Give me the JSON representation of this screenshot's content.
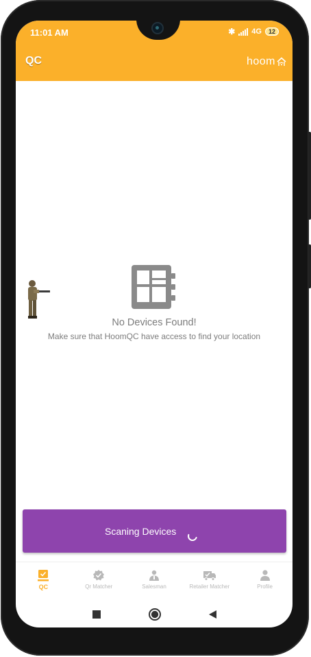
{
  "status_bar": {
    "time": "11:01 AM",
    "network": "4G",
    "battery": "12"
  },
  "app_bar": {
    "title": "QC",
    "logo_text": "hoom",
    "logo_icon": "wifi-home-icon",
    "color": "#fbb02a"
  },
  "empty_state": {
    "icon": "device-chip-icon",
    "title": "No Devices Found!",
    "message": "Make sure that HoomQC have access to find your location"
  },
  "scan_button": {
    "label": "Scaning Devices",
    "color": "#8e44ad"
  },
  "bottom_nav": {
    "items": [
      {
        "label": "QC",
        "icon": "qc-monitor-icon",
        "active": true
      },
      {
        "label": "Qr Matcher",
        "icon": "verified-badge-icon",
        "active": false
      },
      {
        "label": "Salesman",
        "icon": "salesman-icon",
        "active": false
      },
      {
        "label": "Retailer Matcher",
        "icon": "truck-check-icon",
        "active": false
      },
      {
        "label": "Profile",
        "icon": "person-icon",
        "active": false
      }
    ]
  },
  "system_nav": {
    "items": [
      "recents-square-icon",
      "home-circle-icon",
      "back-triangle-icon"
    ]
  }
}
